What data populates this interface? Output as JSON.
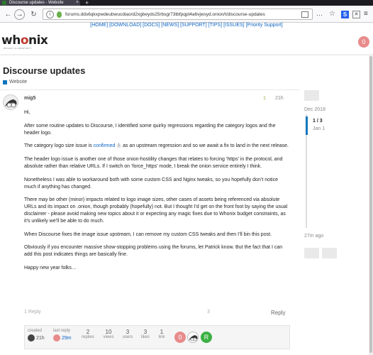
{
  "browser": {
    "tab_title": "Discourse updates - Website",
    "new_tab_symbol": "+",
    "url": "forums.dds6qkxpwdeubwucdiaord2xgbeyds25rbsgr73tbfpqpt4a6vjwsyd.onion/t/discourse-updates",
    "back_symbol": "←",
    "forward_symbol": "→",
    "reload_symbol": "↻",
    "more_symbol": "⋯",
    "star_symbol": "☆",
    "ext_s_label": "S",
    "menu_symbol": "≡"
  },
  "linkbar": {
    "items": [
      "[HOME]",
      "[DOWNLOAD]",
      "[DOCS]",
      "[NEWS]",
      "[SUPPORT]",
      "[TIPS]",
      "[ISSUES]",
      "[Priority Support]"
    ]
  },
  "header": {
    "logo_prefix": "wh",
    "logo_o": "o",
    "logo_suffix": "nix",
    "logo_sub": "PRIVACY & ANONYMITY",
    "avatar_letter": "0",
    "avatar_color": "#e88b8b"
  },
  "topic": {
    "title": "Discourse updates",
    "category": "Website",
    "category_color": "#0e76bd"
  },
  "post": {
    "username": "mig5",
    "edit_count": "1",
    "time": "21h",
    "paragraphs": [
      "Hi,",
      "After some routine updates to Discourse, I identified some quirky regressions regarding the category logos and the header logo.",
      "The header logo issue is another one of those onion-hostility changes that relates to forcing ‘https’ in the protocol, and absolute rather than relative URLs. If I switch on ‘force_https’ mode, I break the onion service entirely I think.",
      "Nonetheless I was able to workaround both with some custom CSS and Nginx tweaks, so you hopefully don’t notice much if anything has changed.",
      "There may be other (minor) impacts related to logo image sizes, other cases of assets being referenced via absolute URLs and its impact on .onion, though probably (hopefully) not. But I thought I’d get on the front foot by saying the usual disclaimer - please avoid making new topics about it or expecting any magic fixes due to Whonix budget constraints, as it’s unlikely we’ll be able to do much.",
      "When Discourse fixes the image issue upstream, I can remove my custom CSS tweaks and then I’ll bin this post.",
      "Obviously if you encounter massive show-stopping problems using the forums, let Patrick know. But the fact that I can add this post indicates things are basically fine.",
      "Happy new year folks…"
    ],
    "logo_para_before": "The category logo size issue is ",
    "logo_para_link": "confirmed",
    "logo_para_clicks": "1",
    "logo_para_after": " as an upstream regression and so we await a fix to land in the next release.",
    "reply_count": "1 Reply",
    "like_count": "3",
    "reply_button": "Reply"
  },
  "topic_map": {
    "created_label": "created",
    "created_time": "21h",
    "last_reply_label": "last reply",
    "last_reply_time": "29m",
    "replies": "2",
    "replies_label": "replies",
    "views": "10",
    "views_label": "views",
    "users": "3",
    "users_label": "users",
    "likes": "3",
    "likes_label": "likes",
    "links": "1",
    "links_label": "link",
    "participant_1_letter": "0",
    "participant_3_letter": "R"
  },
  "timeline": {
    "start_date": "Dec 2018",
    "position": "1 / 3",
    "position_date": "Jan 1",
    "last_ago": "27m ago"
  }
}
